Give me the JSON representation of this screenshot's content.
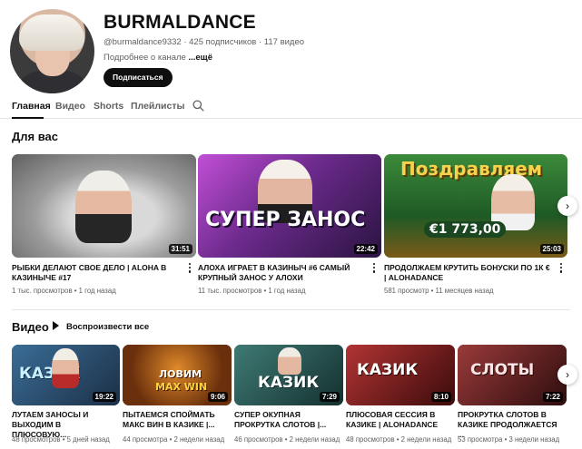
{
  "channel": {
    "name": "BURMALDANCE",
    "meta": "@burmaldance9332 · 425 подписчиков · 117 видео",
    "about": "Подробнее о канале",
    "about_more": "...ещё",
    "subscribe_label": "Подписаться"
  },
  "tabs": [
    {
      "label": "Главная"
    },
    {
      "label": "Видео"
    },
    {
      "label": "Shorts"
    },
    {
      "label": "Плейлисты"
    }
  ],
  "for_you": {
    "title": "Для вас",
    "videos": [
      {
        "title": "РЫБКИ ДЕЛАЮТ СВОЕ ДЕЛО | ALOHA В КАЗИНЫЧЕ #17",
        "meta": "1 тыс. просмотров • 1 год назад",
        "duration": "31:51"
      },
      {
        "title": "АЛОХА ИГРАЕТ В КАЗИНЫЧ #6 САМЫЙ КРУПНЫЙ ЗАНОС У АЛОХИ",
        "meta": "11 тыс. просмотров • 1 год назад",
        "duration": "22:42",
        "overlay": "СУПЕР ЗАНОС"
      },
      {
        "title": "ПРОДОЛЖАЕМ КРУТИТЬ БОНУСКИ ПО 1К € | ALOHADANCE",
        "meta": "581 просмотр • 11 месяцев назад",
        "duration": "25:03",
        "overlay": "Поздравляем",
        "overlay2": "€1 773,00"
      }
    ]
  },
  "videos_section": {
    "title": "Видео",
    "play_all": "Воспроизвести все",
    "videos": [
      {
        "title": "ЛУТАЕМ ЗАНОСЫ И ВЫХОДИМ В ПЛЮСОВУЮ...",
        "meta": "48 просмотров • 5 дней назад",
        "duration": "19:22",
        "overlay": "КАЗИК"
      },
      {
        "title": "ПЫТАЕМСЯ СПОЙМАТЬ МАКС ВИН В КАЗИКЕ |...",
        "meta": "44 просмотра • 2 недели назад",
        "duration": "9:06",
        "overlay": "ЛОВИМ",
        "overlay2": "MAX WIN"
      },
      {
        "title": "СУПЕР ОКУПНАЯ ПРОКРУТКА СЛОТОВ |...",
        "meta": "46 просмотров • 2 недели назад",
        "duration": "7:29",
        "overlay": "КАЗИК"
      },
      {
        "title": "ПЛЮСОВАЯ СЕССИЯ В КАЗИКЕ | ALOHADANCE",
        "meta": "48 просмотров • 2 недели назад",
        "duration": "8:10",
        "overlay": "КАЗИК"
      },
      {
        "title": "ПРОКРУТКА СЛОТОВ В КАЗИКЕ ПРОДОЛЖАЕТСЯ ...",
        "meta": "53 просмотра • 3 недели назад",
        "duration": "7:22",
        "overlay": "СЛОТЫ"
      }
    ]
  },
  "icons": {
    "search": "search-icon",
    "next": "chevron-right-icon",
    "more": "more-vert-icon",
    "play": "play-icon"
  }
}
